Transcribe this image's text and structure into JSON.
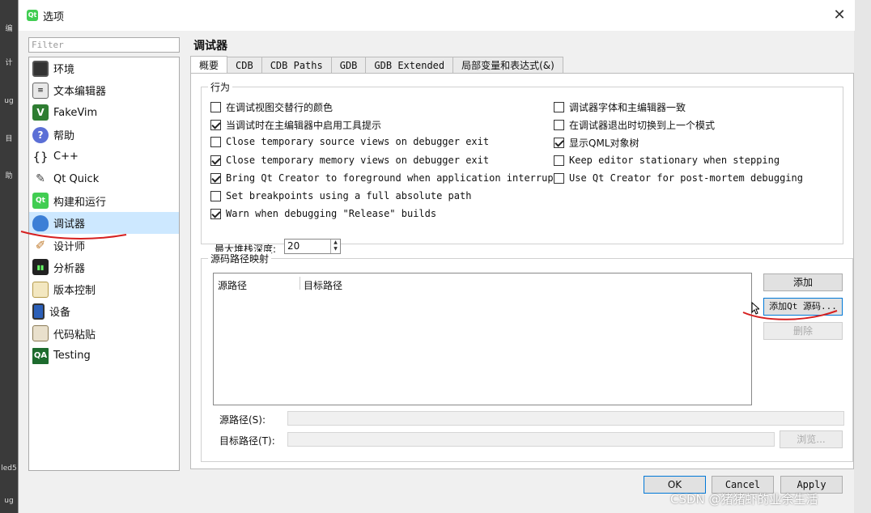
{
  "window": {
    "title": "选项",
    "close_label": "✕"
  },
  "filter": {
    "placeholder": "Filter"
  },
  "nav": {
    "items": [
      {
        "label": "环境",
        "icon": "monitor-icon"
      },
      {
        "label": "文本编辑器",
        "icon": "text-editor-icon"
      },
      {
        "label": "FakeVim",
        "icon": "fakevim-icon"
      },
      {
        "label": "帮助",
        "icon": "help-icon"
      },
      {
        "label": "C++",
        "icon": "braces-icon"
      },
      {
        "label": "Qt Quick",
        "icon": "qt-quick-icon"
      },
      {
        "label": "构建和运行",
        "icon": "build-run-icon"
      },
      {
        "label": "调试器",
        "icon": "debugger-icon"
      },
      {
        "label": "设计师",
        "icon": "designer-icon"
      },
      {
        "label": "分析器",
        "icon": "analyzer-icon"
      },
      {
        "label": "版本控制",
        "icon": "version-control-icon"
      },
      {
        "label": "设备",
        "icon": "device-icon"
      },
      {
        "label": "代码粘贴",
        "icon": "code-paste-icon"
      },
      {
        "label": "Testing",
        "icon": "qa-testing-icon"
      }
    ],
    "selected": "调试器"
  },
  "page": {
    "title": "调试器",
    "tabs": [
      "概要",
      "CDB",
      "CDB Paths",
      "GDB",
      "GDB Extended",
      "局部变量和表达式(&)"
    ],
    "active_tab": "概要"
  },
  "behavior": {
    "title": "行为",
    "left_options": [
      {
        "label": "在调试视图交替行的颜色",
        "checked": false
      },
      {
        "label": "当调试时在主编辑器中启用工具提示",
        "checked": true
      },
      {
        "label": "Close temporary source views on debugger exit",
        "checked": false
      },
      {
        "label": "Close temporary memory views on debugger exit",
        "checked": true
      },
      {
        "label": "Bring Qt Creator to foreground when application interrupts",
        "checked": true
      },
      {
        "label": "Set breakpoints using a full absolute path",
        "checked": false
      },
      {
        "label": "Warn when debugging \"Release\" builds",
        "checked": true
      }
    ],
    "right_options": [
      {
        "label": "调试器字体和主编辑器一致",
        "checked": false
      },
      {
        "label": "在调试器退出时切换到上一个模式",
        "checked": false
      },
      {
        "label": "显示QML对象树",
        "checked": true
      },
      {
        "label": "Keep editor stationary when stepping",
        "checked": false
      },
      {
        "label": "Use Qt Creator for post-mortem debugging",
        "checked": false
      }
    ],
    "stack_depth_label": "最大堆栈深度:",
    "stack_depth_value": "20"
  },
  "source_map": {
    "title": "源码路径映射",
    "col_source": "源路径",
    "col_target": "目标路径",
    "add_label": "添加",
    "add_qt_label": "添加Qt 源码...",
    "remove_label": "删除",
    "source_field_label": "源路径(S):",
    "target_field_label": "目标路径(T):",
    "browse_label": "浏览..."
  },
  "footer": {
    "ok": "OK",
    "cancel": "Cancel",
    "apply": "Apply"
  },
  "leftbar": {
    "labels": [
      "编",
      "计",
      "ug",
      "目",
      "助",
      "led5",
      "ug"
    ]
  },
  "watermark": "CSDN @猪猪虾的业余生活",
  "colors": {
    "selection": "#cde8ff",
    "annotation": "#d62020",
    "focus": "#0078d7"
  }
}
